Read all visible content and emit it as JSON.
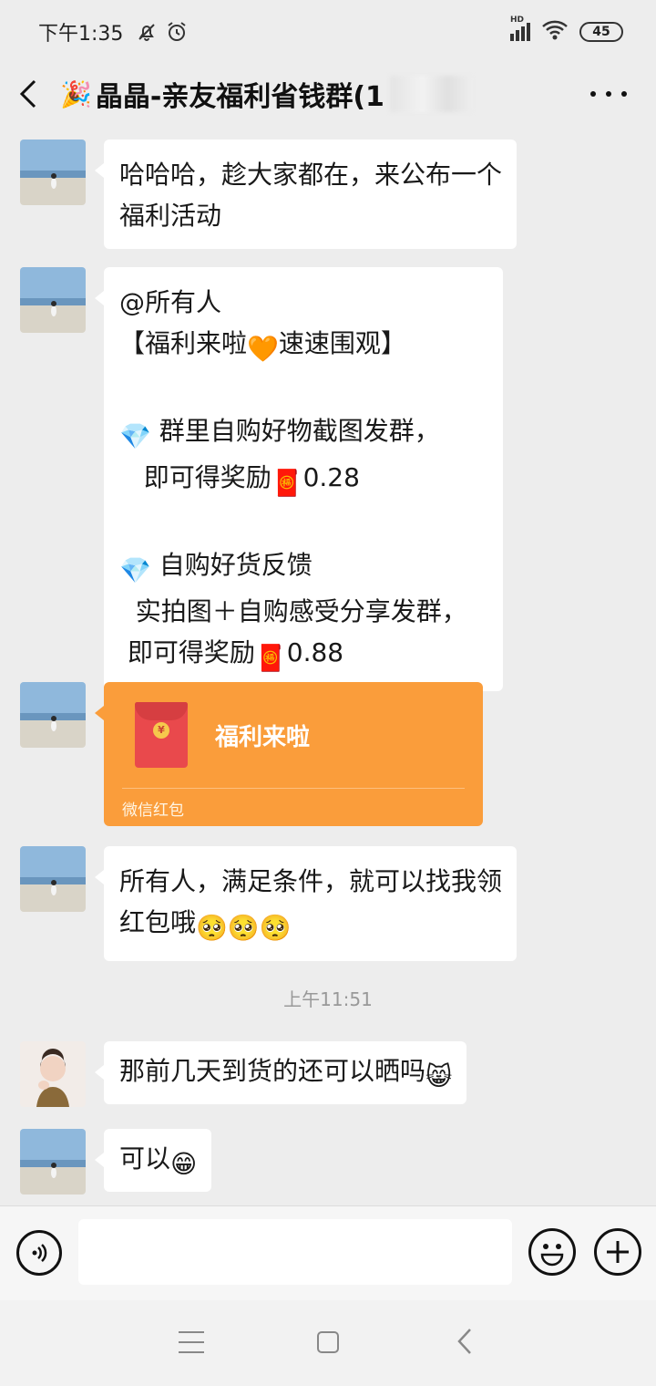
{
  "status_bar": {
    "time": "下午1:35",
    "signal_label": "HD",
    "battery": "45",
    "icons": [
      "mute-bell-icon",
      "alarm-icon",
      "signal-icon",
      "wifi-icon",
      "battery-icon"
    ]
  },
  "header": {
    "title_emoji": "🎉",
    "title": "晶晶-亲友福利省钱群(1",
    "back_icon": "chevron-left-icon",
    "more_icon": "more-dots-icon"
  },
  "messages": [
    {
      "lines": [
        "哈哈哈，趁大家都在，来公布一个",
        "福利活动"
      ]
    },
    {
      "line1": "@所有人",
      "line2_a": "【福利来啦",
      "line2_emoji": "🧡",
      "line2_b": "速速围观】",
      "item1_emoji": "💎",
      "item1_a": " 群里自购好物截图发群，",
      "item1_b_text": "   即可得奖励",
      "item1_b_emoji": "🧧",
      "item1_b_value": "0.28",
      "item2_emoji": "💎",
      "item2_a": " 自购好货反馈",
      "item2_b": "  实拍图＋自购感受分享发群，",
      "item2_c_text": " 即可得奖励",
      "item2_c_emoji": "🧧",
      "item2_c_value": "0.88"
    },
    {
      "red_packet_title": "福利来啦",
      "red_packet_footer": "微信红包",
      "coin_symbol": "¥"
    },
    {
      "lines": [
        "所有人，满足条件，就可以找我领",
        "红包哦"
      ],
      "emojis": "🥺🥺🥺"
    },
    {
      "text": "那前几天到货的还可以晒吗",
      "emoji": "😸"
    },
    {
      "text": "可以",
      "emoji": "😁"
    }
  ],
  "timestamp": "上午11:51",
  "input_bar": {
    "voice_icon": "voice-icon",
    "emoji_icon": "emoji-icon",
    "plus_icon": "plus-icon",
    "input_value": ""
  },
  "colors": {
    "background": "#ededed",
    "bubble": "#ffffff",
    "red_packet": "#fa9d3b"
  }
}
